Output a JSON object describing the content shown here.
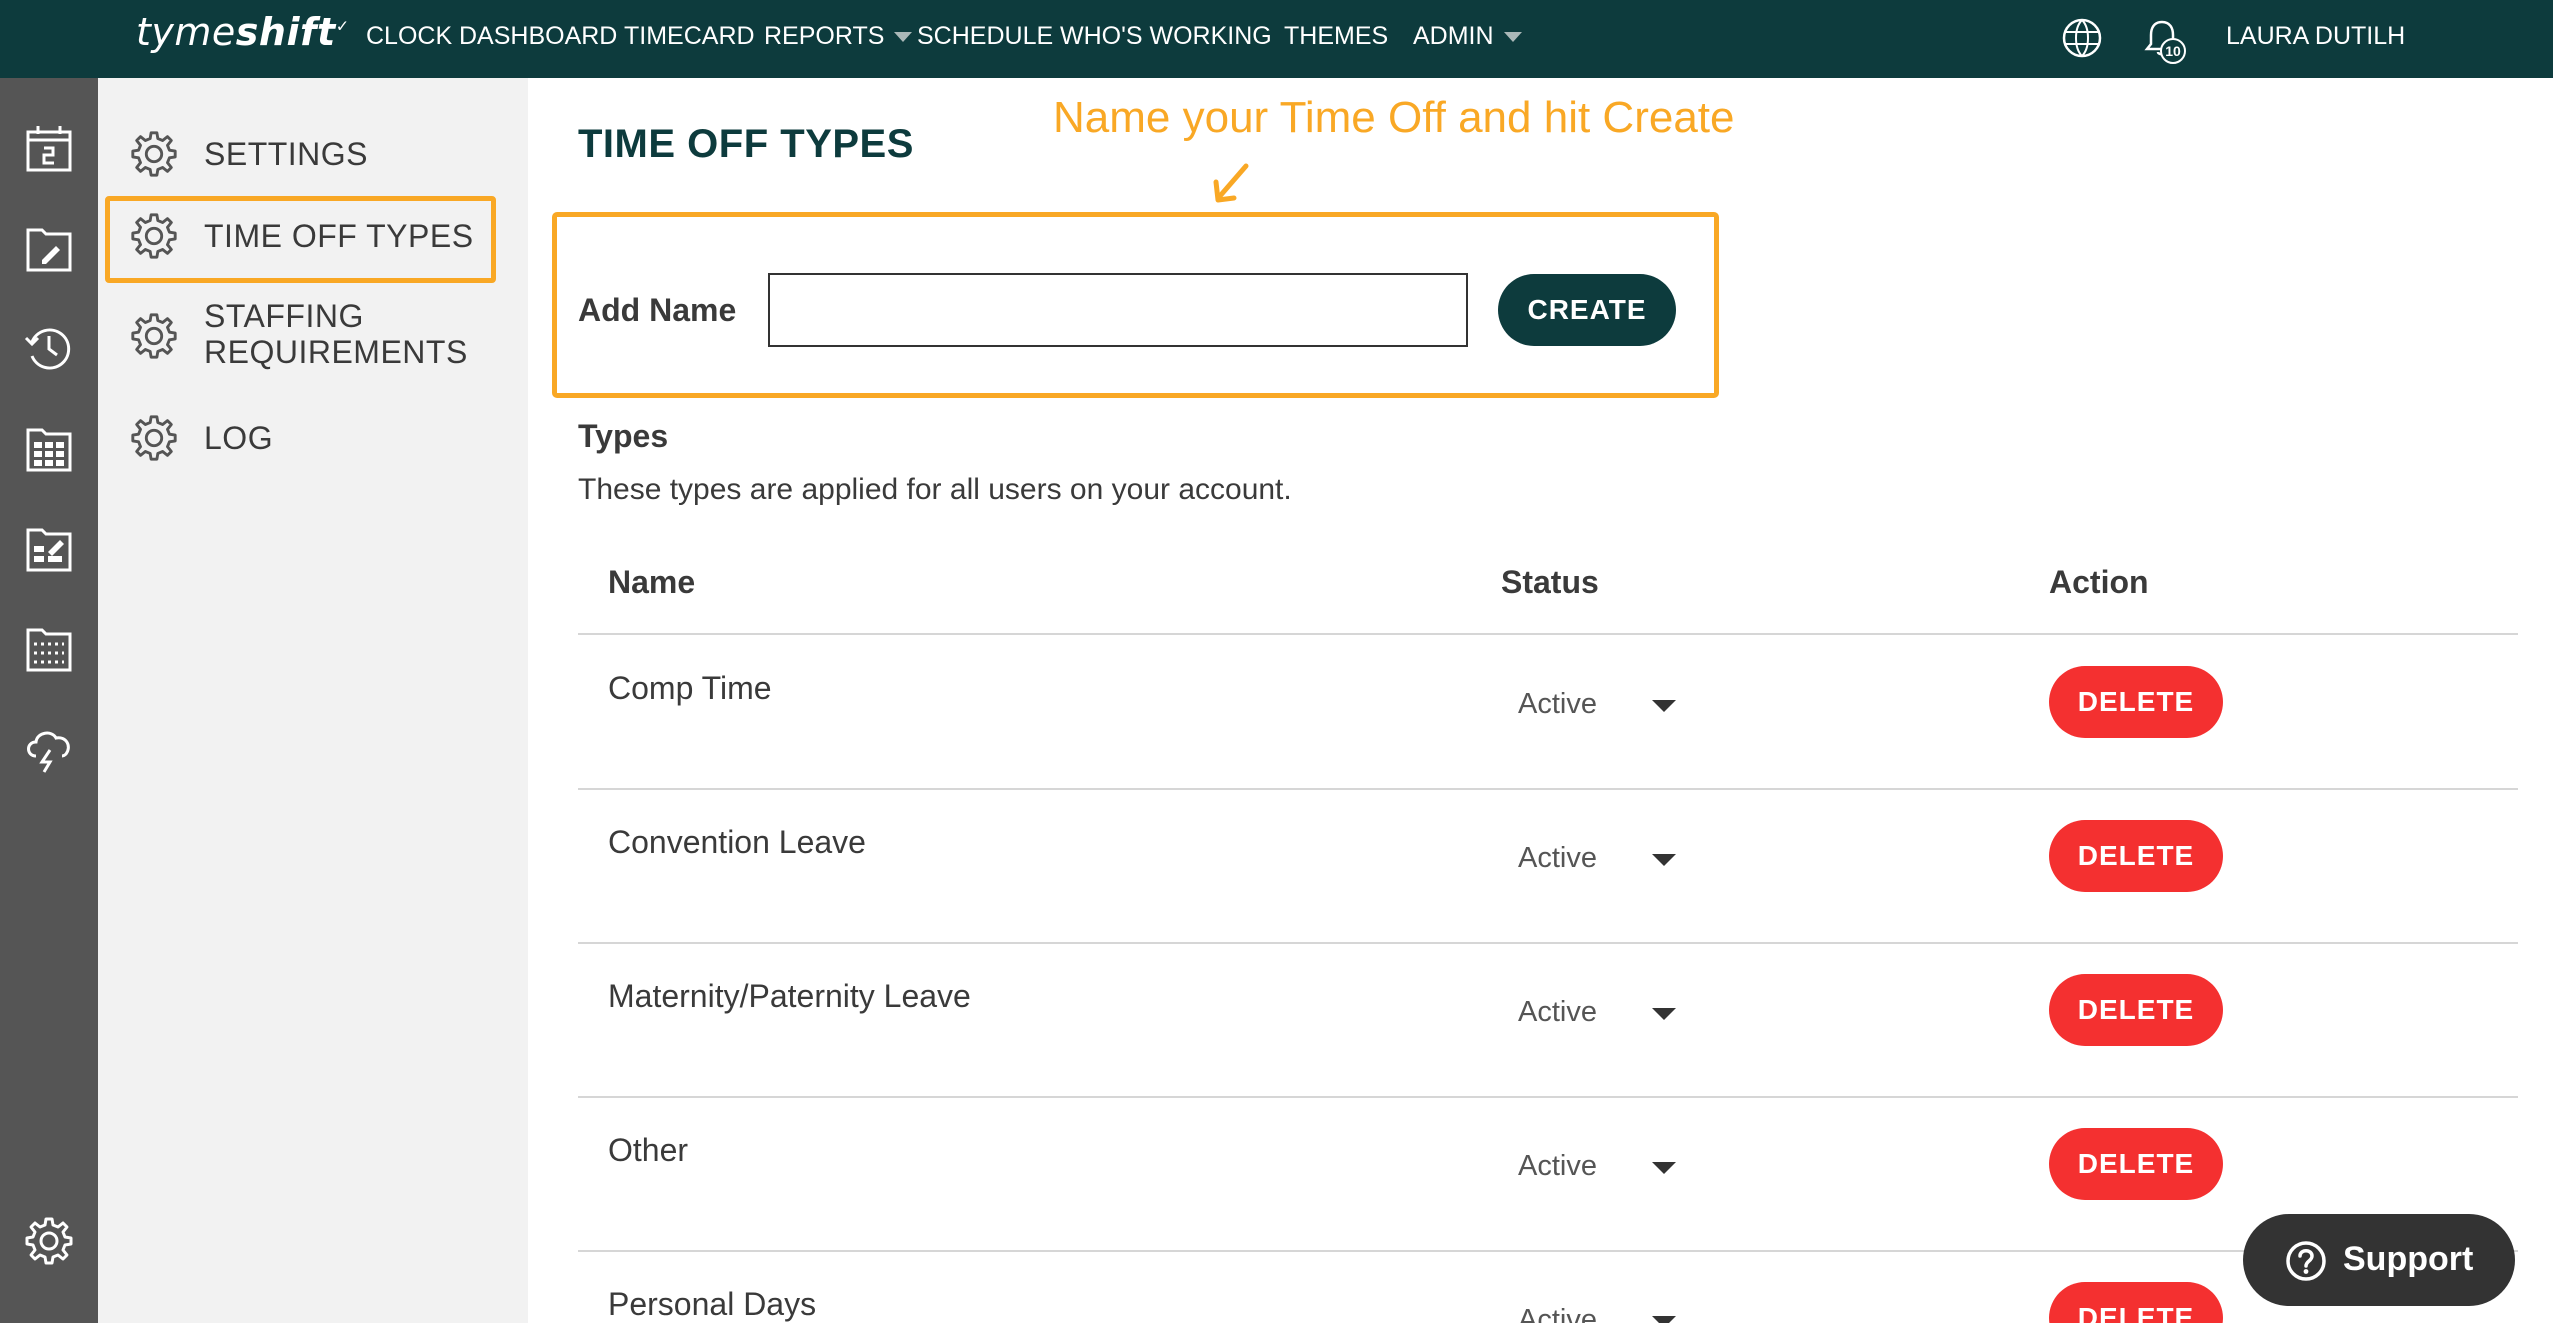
{
  "topbar": {
    "logo_light": "tyme",
    "logo_bold": "shift",
    "logo_mark": "✓",
    "nav": {
      "clock": "CLOCK",
      "dashboard": "DASHBOARD",
      "timecard": "TIMECARD",
      "reports": "REPORTS",
      "schedule": "SCHEDULE",
      "whos_working": "WHO'S WORKING",
      "themes": "THEMES",
      "admin": "ADMIN"
    },
    "notification_count": "10",
    "user_name": "LAURA DUTILH"
  },
  "rail": {
    "icons": [
      "calendar-icon",
      "edit-file-icon",
      "time-history-icon",
      "report-grid-icon",
      "chart-edit-icon",
      "schedule-grid-icon",
      "cloud-storm-icon",
      "settings-gear-icon"
    ]
  },
  "sidebar": {
    "settings": "SETTINGS",
    "time_off_types": "TIME OFF TYPES",
    "staffing_line1": "STAFFING",
    "staffing_line2": "REQUIREMENTS",
    "log": "LOG"
  },
  "main": {
    "title": "TIME OFF TYPES",
    "annotation": "Name your Time Off and hit Create",
    "add_name_label": "Add Name",
    "name_input_value": "",
    "create_label": "CREATE",
    "types_heading": "Types",
    "types_description": "These types are applied for all users on your account.",
    "columns": {
      "name": "Name",
      "status": "Status",
      "action": "Action"
    },
    "rows": [
      {
        "name": "Comp Time",
        "status": "Active",
        "action": "DELETE"
      },
      {
        "name": "Convention Leave",
        "status": "Active",
        "action": "DELETE"
      },
      {
        "name": "Maternity/Paternity Leave",
        "status": "Active",
        "action": "DELETE"
      },
      {
        "name": "Other",
        "status": "Active",
        "action": "DELETE"
      },
      {
        "name": "Personal Days",
        "status": "Active",
        "action": "DELETE"
      }
    ]
  },
  "support": {
    "label": "Support"
  },
  "colors": {
    "topbar": "#0d3b3d",
    "rail": "#555555",
    "sidebar": "#f2f2f2",
    "highlight": "#f9a825",
    "delete": "#f43030",
    "create": "#0d3b3d"
  }
}
